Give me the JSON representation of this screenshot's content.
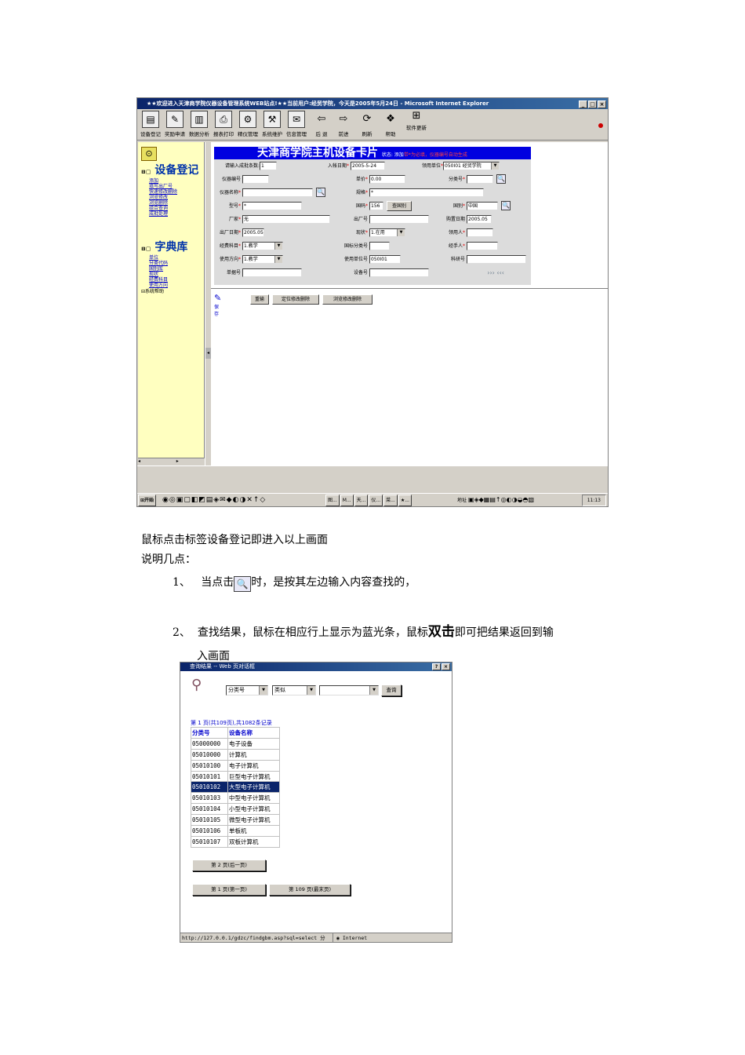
{
  "screenshot1": {
    "window_title": "★★欢迎进入天津商学院仪器设备管理系统WEB站点!★★当前用户:经贸学院，今天是2005年5月24日 - Microsoft Internet Explorer",
    "window_controls": [
      "_",
      "□",
      "×"
    ],
    "toolbar": [
      {
        "label": "设备登记",
        "icon": "register-icon"
      },
      {
        "label": "奖励申请",
        "icon": "reward-icon"
      },
      {
        "label": "数据分析",
        "icon": "analysis-icon"
      },
      {
        "label": "报表打印",
        "icon": "print-icon"
      },
      {
        "label": "精仪管理",
        "icon": "precision-icon"
      },
      {
        "label": "系统维护",
        "icon": "maintenance-icon"
      },
      {
        "label": "信息管理",
        "icon": "info-icon"
      },
      {
        "label": "后 退",
        "icon": "back-arrow-icon"
      },
      {
        "label": "前进",
        "icon": "forward-arrow-icon"
      },
      {
        "label": "刷新",
        "icon": "refresh-icon"
      },
      {
        "label": "帮助",
        "icon": "help-icon"
      },
      {
        "label": "软件更新",
        "icon": "update-icon"
      }
    ],
    "sidebar": {
      "group1_title": "设备登记",
      "group1_items": [
        "添加",
        "填写出厂号",
        "快速修改删除",
        "浏览修改",
        "浏览删除",
        "组合查询",
        "成批处理"
      ],
      "group2_title": "字典库",
      "group2_items": [
        "单位",
        "分类代码",
        "国别库",
        "现状",
        "经费科目",
        "使用方向"
      ],
      "help": "系统帮助"
    },
    "card": {
      "title": "天津商学院主机设备卡片",
      "status_prefix": "状态: 添加",
      "status_red": "带*为必填，仪器编号自动生成",
      "fields": {
        "batch_label": "请输入成批条数:",
        "batch_value": "1",
        "entry_date_label": "入帐日期",
        "entry_date_value": "2005-5-24",
        "dept_label": "领用单位",
        "dept_value": "050I01 经贸学院",
        "device_no_label": "仪器编号",
        "device_no_value": "",
        "price_label": "单价",
        "price_value": "0.00",
        "category_label": "分类号",
        "category_value": "",
        "device_name_label": "仪器名称",
        "device_name_value": "",
        "spec_label": "规格",
        "spec_value": "*",
        "model_label": "型号",
        "model_value": "*",
        "country_code_label": "国码",
        "country_code_value": "156",
        "country_lookup_btn": "查国别",
        "country_label": "国别",
        "country_value": "中国",
        "maker_label": "厂家",
        "maker_value": "无",
        "serial_label": "出厂号",
        "serial_value": "",
        "purchase_date_label": "购置日期",
        "purchase_date_value": "2005.05",
        "mfg_date_label": "出厂日期",
        "mfg_date_value": "2005.05",
        "state_label": "现状",
        "state_value": "1.在用",
        "receiver_label": "领用人",
        "receiver_value": "",
        "fund_label": "经费科目",
        "fund_value": "1.教学",
        "intl_cat_label": "国标分类号",
        "intl_cat_value": "",
        "handler_label": "经手人",
        "handler_value": "",
        "usage_label": "使用方向",
        "usage_value": "1.教学",
        "use_unit_label": "使用单位号",
        "use_unit_value": "050I01",
        "research_label": "科研号",
        "research_value": "",
        "voucher_label": "单据号",
        "voucher_value": "",
        "equip_no_label": "设备号",
        "equip_no_value": "",
        "nav": "››› ‹‹‹"
      },
      "actions": {
        "save": "保存",
        "reset": "重输",
        "locate_delete": "定位修改删除",
        "browse_delete": "浏览修改删除"
      }
    },
    "taskbar": {
      "start": "开始",
      "tasks": [
        "图...",
        "M...",
        "天...",
        "仪...",
        "菜...",
        "★..."
      ],
      "address": "地址",
      "clock": "11:13"
    }
  },
  "text": {
    "line1": "鼠标点击标签设备登记即进入以上画面",
    "line2": "说明几点：",
    "item1_num": "1、",
    "item1_pre": "当点击",
    "item1_post": "时，是按其左边输入内容查找的，",
    "item2_num": "2、",
    "item2_pre": "查找结果，鼠标在相应行上显示为蓝光条，鼠标",
    "item2_bold": "双击",
    "item2_post": "即可把结果返回到输",
    "item2_cont": "入画面"
  },
  "screenshot2": {
    "title": "查询结果 -- Web 页对话框",
    "controls": [
      "?",
      "×"
    ],
    "field_select": "分类号",
    "match_select": "类似",
    "query_input": "",
    "query_btn": "查询",
    "page_info": "第 1 页(共109页),共1082条记录",
    "headers": [
      "分类号",
      "设备名称"
    ],
    "rows": [
      [
        "05000000",
        "电子设备"
      ],
      [
        "05010000",
        "计算机"
      ],
      [
        "05010100",
        "电子计算机"
      ],
      [
        "05010101",
        "巨型电子计算机"
      ],
      [
        "05010102",
        "大型电子计算机"
      ],
      [
        "05010103",
        "中型电子计算机"
      ],
      [
        "05010104",
        "小型电子计算机"
      ],
      [
        "05010105",
        "微型电子计算机"
      ],
      [
        "05010106",
        "单板机"
      ],
      [
        "05010107",
        "双板计算机"
      ]
    ],
    "highlighted_row": 4,
    "next_btn": "第 2 页(后一页)",
    "first_btn": "第 1 页(第一页)",
    "last_btn": "第 109 页(最末页)",
    "status_url": "http://127.0.0.1/gdzc/findgbm.asp?sql=select 分",
    "status_zone": "Internet"
  }
}
